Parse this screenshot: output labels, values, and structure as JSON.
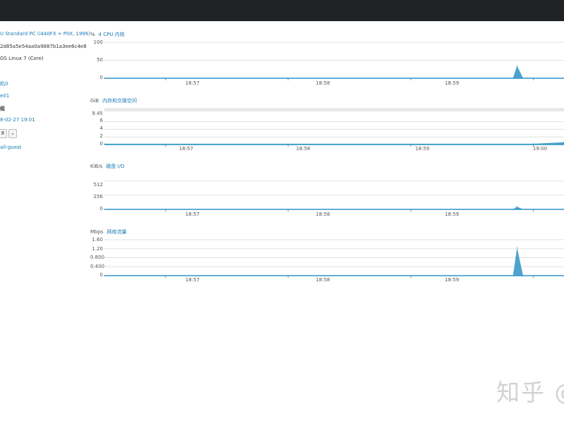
{
  "sidebar": {
    "machine_type": "U Standard PC (i440FX + PIIX, 1996)",
    "uuid": "2d85a5e54aa0a9887b1a3ee6c4e8",
    "os": "OS Linux 7 (Core)",
    "link1": "机0",
    "link2": "e01",
    "label_bold": "组",
    "timestamp": "8-02-27 19:01",
    "ctrl_value": "8",
    "ctrl_dropdown": "⌄",
    "link3": "all-guest"
  },
  "charts": {
    "cpu": {
      "unit": "%",
      "title": "4 CPU 内核",
      "yticks": [
        "100",
        "50",
        "0"
      ],
      "xticks": [
        "18:57",
        "18:58",
        "18:59"
      ]
    },
    "memory": {
      "unit": "GiB",
      "title": "内存和交换空间",
      "yticks": [
        "9.45",
        "6",
        "4",
        "2",
        "0"
      ],
      "xticks": [
        "18:57",
        "18:58",
        "18:59",
        "19:00"
      ]
    },
    "disk": {
      "unit": "KiB/s",
      "title": "磁盘 I/O",
      "yticks": [
        "512",
        "256",
        "0"
      ],
      "xticks": [
        "18:57",
        "18:58",
        "18:59"
      ]
    },
    "network": {
      "unit": "Mbps",
      "title": "网络流量",
      "yticks": [
        "1.60",
        "1.20",
        "0.800",
        "0.400",
        "0"
      ],
      "xticks": [
        "18:57",
        "18:58",
        "18:59"
      ]
    }
  },
  "chart_data": [
    {
      "type": "area",
      "title": "4 CPU 内核",
      "ylabel": "%",
      "ylim": [
        0,
        100
      ],
      "x": [
        "18:56:30",
        "18:59:50",
        "18:59:52",
        "18:59:55",
        "19:00:15"
      ],
      "values": [
        0.5,
        0.5,
        35,
        0.5,
        1
      ]
    },
    {
      "type": "area",
      "title": "内存和交换空间",
      "ylabel": "GiB",
      "ylim": [
        0,
        9.45
      ],
      "x": [
        "18:56:30",
        "19:00:00",
        "19:00:15"
      ],
      "values": [
        0.2,
        0.2,
        0.6
      ]
    },
    {
      "type": "area",
      "title": "磁盘 I/O",
      "ylabel": "KiB/s",
      "ylim": [
        0,
        650
      ],
      "x": [
        "18:56:30",
        "18:59:50",
        "18:59:52",
        "18:59:55",
        "19:00:15"
      ],
      "values": [
        0,
        0,
        50,
        0,
        0
      ]
    },
    {
      "type": "area",
      "title": "网络流量",
      "ylabel": "Mbps",
      "ylim": [
        0,
        1.6
      ],
      "x": [
        "18:56:30",
        "18:59:50",
        "18:59:52",
        "18:59:55",
        "19:00:15"
      ],
      "values": [
        0,
        0,
        1.25,
        0,
        0
      ]
    }
  ],
  "watermark": "知乎 @",
  "colors": {
    "topbar": "#202326",
    "accent": "#1a7bb8",
    "series": "#2f93c6",
    "band": "#e8e8e8",
    "grid": "#e0e0e0"
  }
}
